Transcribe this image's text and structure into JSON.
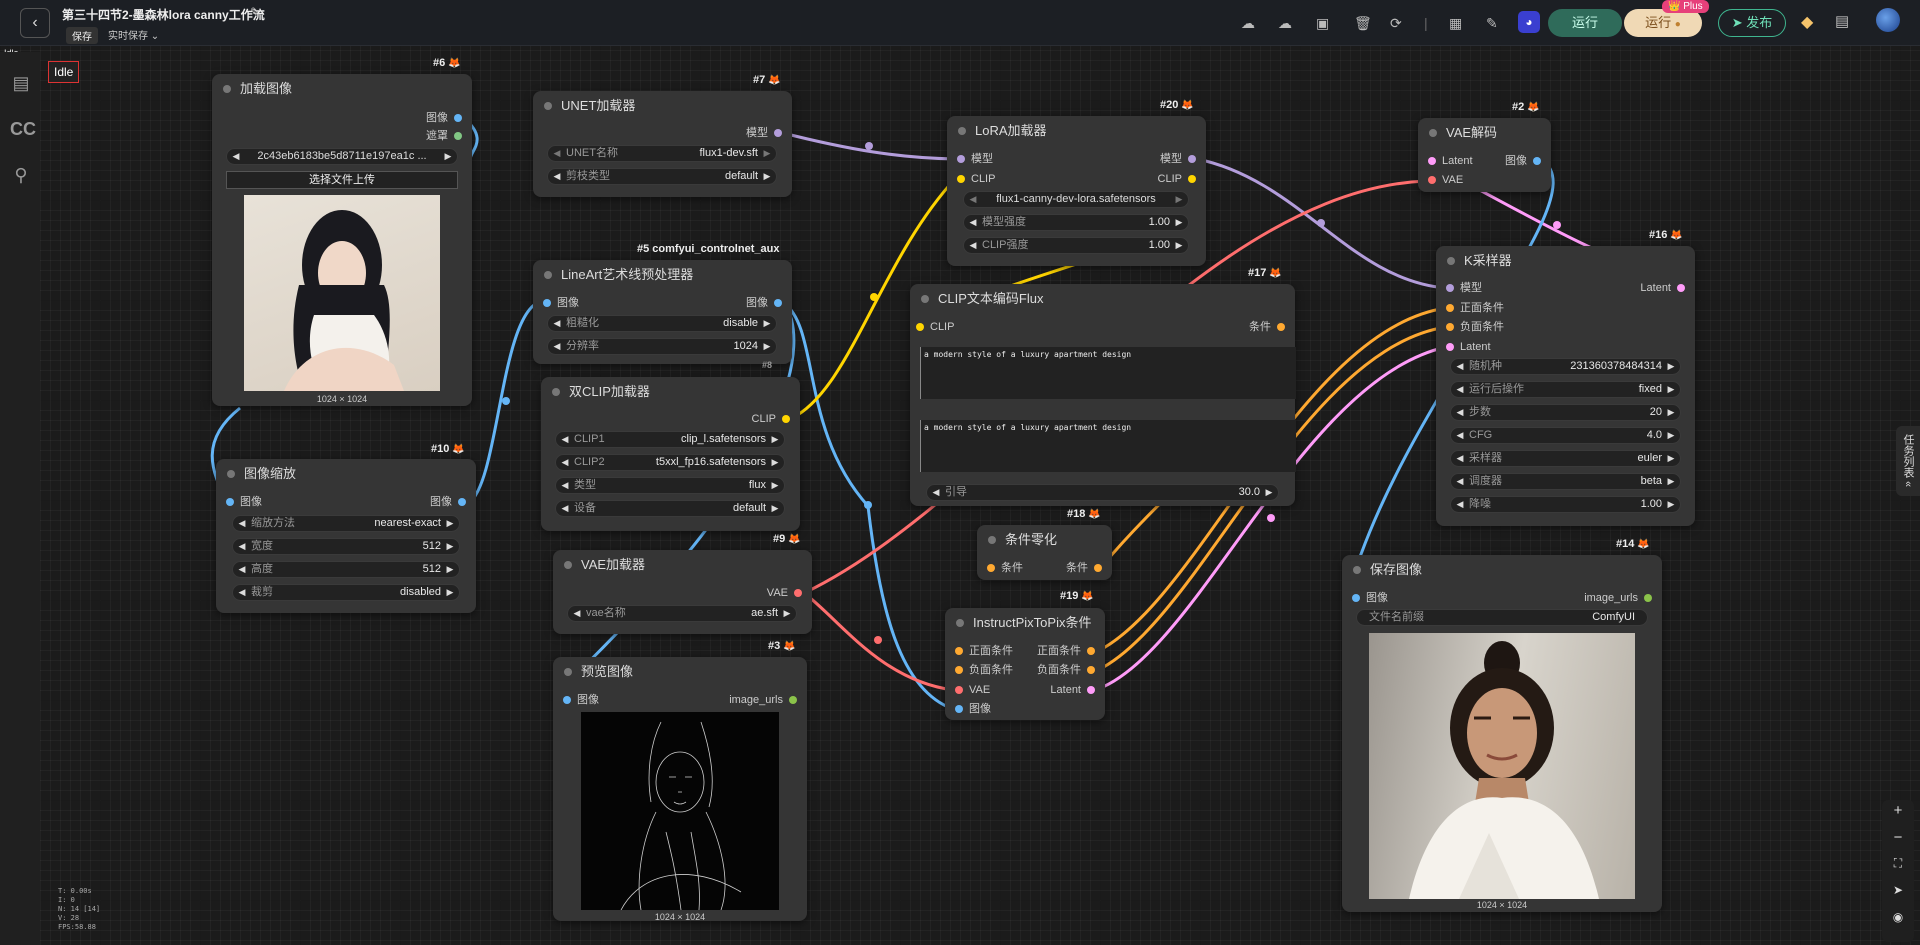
{
  "header": {
    "back_icon": "‹",
    "title": "第三十四节2-墨森林lora canny工作流",
    "edit_icon": "✎",
    "save_label": "保存",
    "autosave_label": "实时保存",
    "dropdown_icon": "⌄",
    "run_label": "运行",
    "run_plus_label": "运行",
    "plus_badge": "👑 Plus",
    "publish_label": "发布"
  },
  "status": {
    "short": "Idle",
    "box": "Idle",
    "stats": [
      "T: 0.00s",
      "I: 0",
      "N: 14 [14]",
      "V: 28",
      "FPS:58.88"
    ]
  },
  "sidebar": {
    "icons": [
      "document-icon",
      "cc-logo-icon",
      "tree-icon"
    ]
  },
  "task_tab": "任务列表 «",
  "zoom": {
    "in": "+",
    "out": "−",
    "fit": "⛶",
    "locate": "➤",
    "eye": "◉"
  },
  "colors": {
    "image": "#64b5f6",
    "mask": "#81c784",
    "model": "#b39ddb",
    "clip": "#ffd500",
    "vae": "#ff6e6e",
    "cond": "#ffa931",
    "latent": "#ff9cf9",
    "imgurls": "#8bc34a"
  },
  "nodes": {
    "n6": {
      "id": "#6",
      "title": "加载图像",
      "out1": "图像",
      "out2": "遮罩",
      "file": "2c43eb6183be5d8711e197ea1c ...",
      "upload": "选择文件上传",
      "size": "1024 × 1024"
    },
    "n10": {
      "id": "#10",
      "title": "图像缩放",
      "in1": "图像",
      "out1": "图像",
      "w": [
        {
          "name": "缩放方法",
          "value": "nearest-exact"
        },
        {
          "name": "宽度",
          "value": "512"
        },
        {
          "name": "高度",
          "value": "512"
        },
        {
          "name": "裁剪",
          "value": "disabled"
        }
      ]
    },
    "n7": {
      "id": "#7",
      "title": "UNET加载器",
      "out1": "模型",
      "w": [
        {
          "name": "UNET名称",
          "value": "flux1-dev.sft"
        },
        {
          "name": "剪枝类型",
          "value": "default"
        }
      ]
    },
    "n5": {
      "id": "#5 comfyui_controlnet_aux",
      "title": "LineArt艺术线预处理器",
      "in1": "图像",
      "out1": "图像",
      "w": [
        {
          "name": "粗糙化",
          "value": "disable"
        },
        {
          "name": "分辨率",
          "value": "1024"
        }
      ]
    },
    "n11": {
      "id": "#8",
      "title": "双CLIP加载器",
      "out1": "CLIP",
      "w": [
        {
          "name": "CLIP1",
          "value": "clip_l.safetensors"
        },
        {
          "name": "CLIP2",
          "value": "t5xxl_fp16.safetensors"
        },
        {
          "name": "类型",
          "value": "flux"
        },
        {
          "name": "设备",
          "value": "default"
        }
      ]
    },
    "n9": {
      "id": "#9",
      "title": "VAE加载器",
      "out1": "VAE",
      "w": [
        {
          "name": "vae名称",
          "value": "ae.sft"
        }
      ]
    },
    "n3": {
      "id": "#3",
      "title": "预览图像",
      "in1": "图像",
      "out1": "image_urls",
      "size": "1024 × 1024"
    },
    "n20": {
      "id": "#20",
      "title": "LoRA加载器",
      "in1": "模型",
      "in2": "CLIP",
      "out1": "模型",
      "out2": "CLIP",
      "lora": "flux1-canny-dev-lora.safetensors",
      "w": [
        {
          "name": "模型强度",
          "value": "1.00"
        },
        {
          "name": "CLIP强度",
          "value": "1.00"
        }
      ]
    },
    "n17": {
      "id": "#17",
      "title": "CLIP文本编码Flux",
      "in1": "CLIP",
      "out1": "条件",
      "text1": "a modern style of a luxury apartment design",
      "text2": "a modern style of a luxury apartment design",
      "w": [
        {
          "name": "引导",
          "value": "30.0"
        }
      ]
    },
    "n18": {
      "id": "#18",
      "title": "条件零化",
      "in1": "条件",
      "out1": "条件"
    },
    "n19": {
      "id": "#19",
      "title": "InstructPixToPix条件",
      "in1": "正面条件",
      "in2": "负面条件",
      "in3": "VAE",
      "in4": "图像",
      "out1": "正面条件",
      "out2": "负面条件",
      "out3": "Latent"
    },
    "n2": {
      "id": "#2",
      "title": "VAE解码",
      "in1": "Latent",
      "in2": "VAE",
      "out1": "图像"
    },
    "n16": {
      "id": "#16",
      "title": "K采样器",
      "in1": "模型",
      "in2": "正面条件",
      "in3": "负面条件",
      "in4": "Latent",
      "out1": "Latent",
      "w": [
        {
          "name": "随机种",
          "value": "231360378484314"
        },
        {
          "name": "运行后操作",
          "value": "fixed"
        },
        {
          "name": "步数",
          "value": "20"
        },
        {
          "name": "CFG",
          "value": "4.0"
        },
        {
          "name": "采样器",
          "value": "euler"
        },
        {
          "name": "调度器",
          "value": "beta"
        },
        {
          "name": "降噪",
          "value": "1.00"
        }
      ]
    },
    "n14": {
      "id": "#14",
      "title": "保存图像",
      "in1": "图像",
      "out1": "image_urls",
      "prefix_name": "文件名前缀",
      "prefix_value": "ComfyUI",
      "size": "1024 × 1024"
    }
  }
}
